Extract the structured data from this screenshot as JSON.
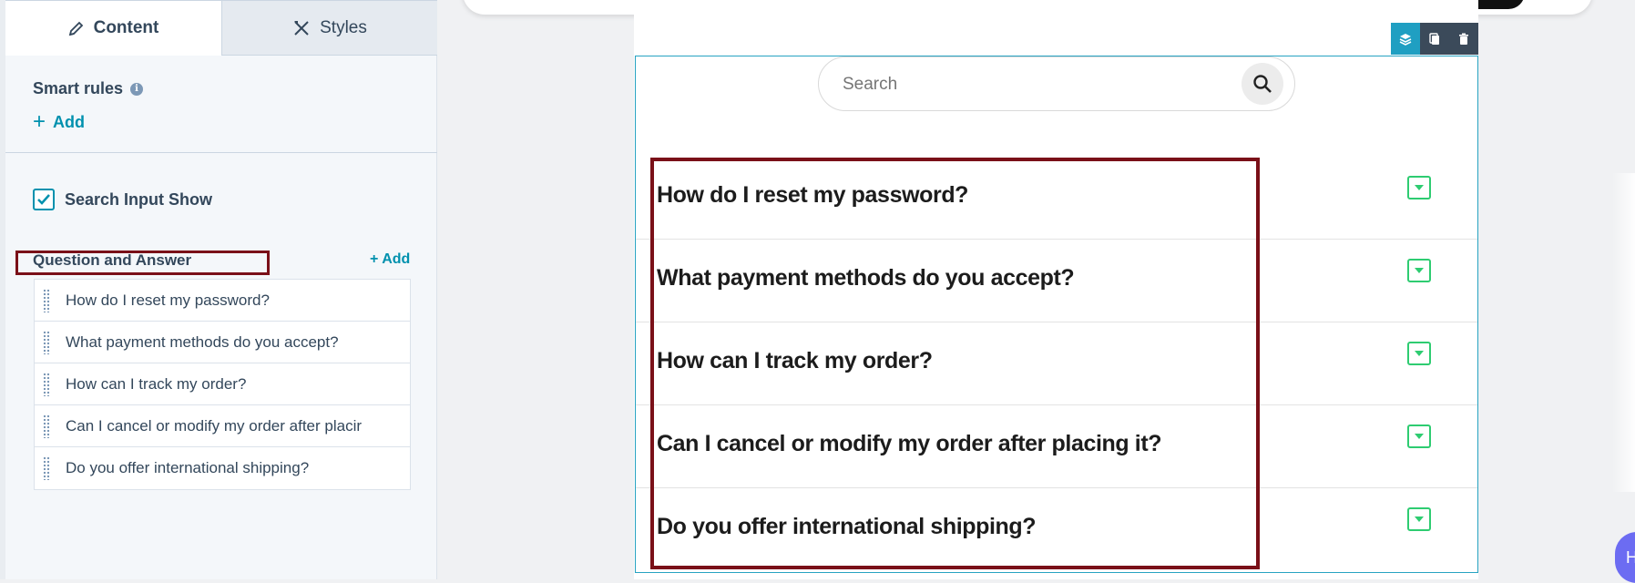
{
  "sidebar": {
    "tabs": [
      {
        "label": "Content",
        "icon": "pencil-icon",
        "active": true
      },
      {
        "label": "Styles",
        "icon": "brush-ruler-icon",
        "active": false
      }
    ],
    "smart_rules": {
      "title": "Smart rules",
      "info_icon": "i",
      "add_label": "Add"
    },
    "search_input_show": {
      "label": "Search Input Show",
      "checked": true
    },
    "qa_section": {
      "title": "Question and Answer",
      "add_label": "+ Add",
      "items": [
        "How do I reset my password?",
        "What payment methods do you accept?",
        "How can I track my order?",
        "Can I cancel or modify my order after placir",
        "Do you offer international shipping?"
      ]
    }
  },
  "preview": {
    "search": {
      "placeholder": "Search",
      "icon": "search-icon"
    },
    "faq": [
      "How do I reset my password?",
      "What payment methods do you accept?",
      "How can I track my order?",
      "Can I cancel or modify my order after placing it?",
      "Do you offer international shipping?"
    ],
    "toolbar": [
      "layers-icon",
      "copy-icon",
      "trash-icon"
    ],
    "help_text": "H"
  },
  "colors": {
    "accent": "#0091ae",
    "highlight": "#7a1018",
    "toggle": "#2ecc71",
    "module_border": "#27a3c2"
  }
}
